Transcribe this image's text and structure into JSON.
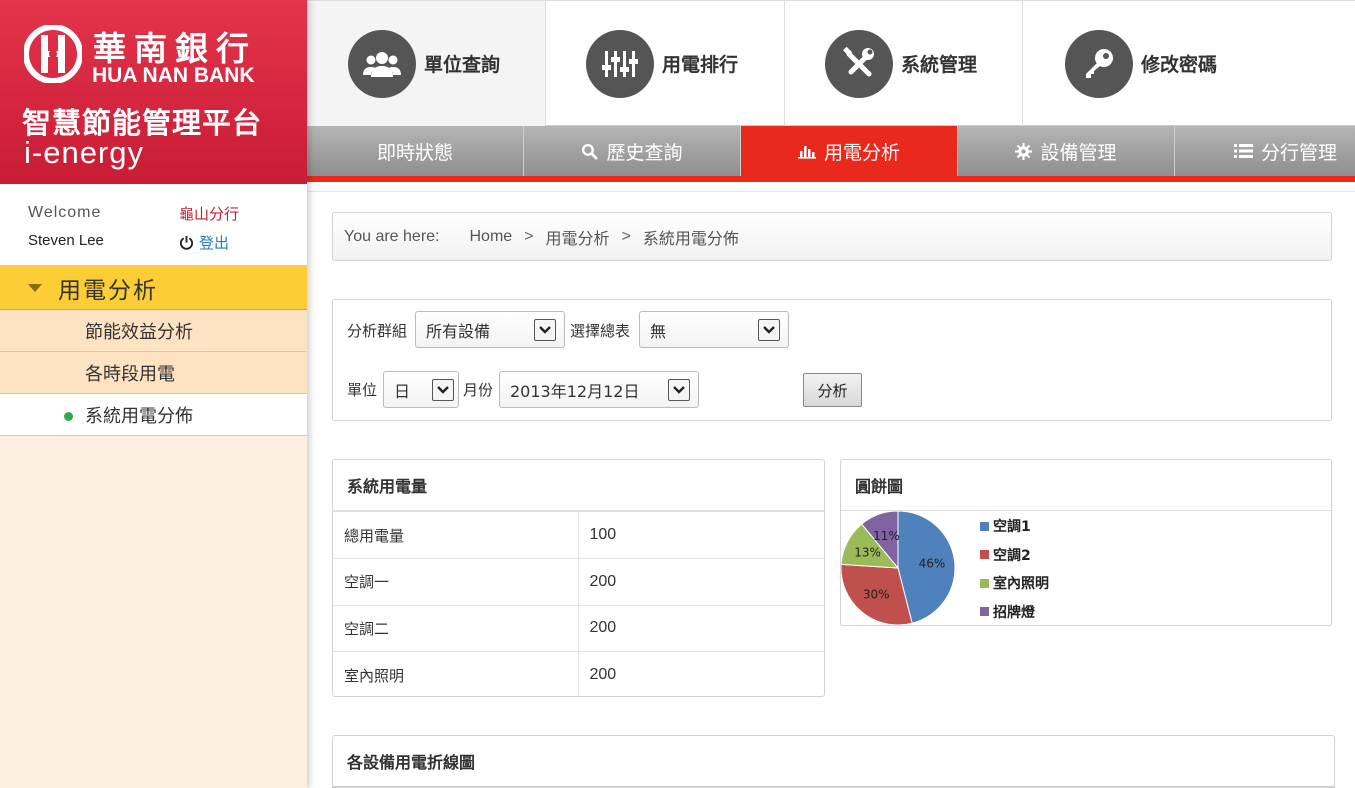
{
  "brand": {
    "bank_cn": "華南銀行",
    "bank_en": "HUA NAN BANK",
    "platform": "智慧節能管理平台",
    "product": "i-energy"
  },
  "user": {
    "welcome": "Welcome",
    "branch": "龜山分行",
    "name": "Steven Lee",
    "logout": "登出"
  },
  "sidebar": {
    "section": "用電分析",
    "items": [
      {
        "label": "節能效益分析"
      },
      {
        "label": "各時段用電"
      },
      {
        "label": "系統用電分佈"
      }
    ],
    "active_index": 2
  },
  "top_nav": [
    {
      "label": "單位查詢",
      "icon": "users-icon"
    },
    {
      "label": "用電排行",
      "icon": "sliders-icon"
    },
    {
      "label": "系統管理",
      "icon": "tools-icon"
    },
    {
      "label": "修改密碼",
      "icon": "key-icon"
    }
  ],
  "tabs": [
    {
      "label": "即時狀態",
      "icon": ""
    },
    {
      "label": "歷史查詢",
      "icon": "search-icon"
    },
    {
      "label": "用電分析",
      "icon": "bar-chart-icon"
    },
    {
      "label": "設備管理",
      "icon": "gear-icon"
    },
    {
      "label": "分行管理",
      "icon": "list-icon"
    }
  ],
  "breadcrumb": {
    "prefix": "You are here:",
    "items": [
      "Home",
      "用電分析",
      "系統用電分佈"
    ],
    "separator": ">"
  },
  "filter": {
    "group_label": "分析群組",
    "group_value": "所有設備",
    "meter_label": "選擇總表",
    "meter_value": "無",
    "unit_label": "單位",
    "unit_value": "日",
    "month_label": "月份",
    "month_value": "2013年12月12日",
    "submit": "分析"
  },
  "usage": {
    "title": "系統用電量",
    "rows": [
      {
        "name": "總用電量",
        "value": "100"
      },
      {
        "name": "空調一",
        "value": "200"
      },
      {
        "name": "空調二",
        "value": "200"
      },
      {
        "name": "室內照明",
        "value": "200"
      }
    ]
  },
  "pie_panel": {
    "title": "圓餅圖"
  },
  "chart_data": {
    "type": "pie",
    "title": "",
    "legend": "right",
    "categories": [
      "空調1",
      "空調2",
      "室內照明",
      "招牌燈"
    ],
    "values": [
      46,
      30,
      13,
      11
    ],
    "labels": [
      "46%",
      "30%",
      "13%",
      "11%"
    ],
    "colors": [
      "#4f81bd",
      "#c0504d",
      "#9bbb59",
      "#8064a2"
    ]
  },
  "line_panel": {
    "title": "各設備用電折線圖"
  },
  "colors": {
    "brand_red": "#d9283f",
    "accent_red": "#e8291c",
    "menu_yellow": "#fdcd35",
    "sidebar_bg": "#fdf0e0"
  }
}
